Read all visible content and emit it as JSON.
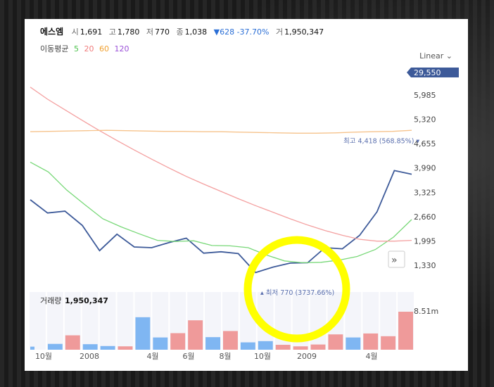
{
  "header": {
    "name": "에스엠",
    "open_label": "시",
    "open": "1,691",
    "high_label": "고",
    "high": "1,780",
    "low_label": "저",
    "low": "770",
    "close_label": "종",
    "close": "1,038",
    "change": "▼628 -37.70%",
    "volume_label": "거",
    "volume": "1,950,347"
  },
  "moving_average": {
    "label": "이동평균",
    "periods": [
      {
        "text": "5",
        "color": "#4cc24c"
      },
      {
        "text": "20",
        "color": "#f07b7b"
      },
      {
        "text": "60",
        "color": "#f0a030"
      },
      {
        "text": "120",
        "color": "#9a50d8"
      }
    ]
  },
  "scale_selector": {
    "label": "Linear",
    "icon": "chevron-down-icon"
  },
  "current_price_tag": "29,550",
  "expand_icon": "double-chevron-right-icon",
  "annotation_color": "#ffff00",
  "chart_data": {
    "type": "line",
    "x_labels": [
      "10월",
      "2008",
      "4월",
      "6월",
      "8월",
      "10월",
      "2009",
      "4월"
    ],
    "price_ticks": [
      "5,985",
      "5,320",
      "4,655",
      "3,990",
      "3,325",
      "2,660",
      "1,995",
      "1,330"
    ],
    "ylim": [
      1000,
      6500
    ],
    "high_marker": {
      "text": "최고 4,418 (568.85%)",
      "value": 4418
    },
    "low_marker": {
      "text": "최저 770 (3737.66%)",
      "value": 770
    },
    "series": [
      {
        "name": "price",
        "color": "#3d5a99",
        "values": [
          3120,
          2760,
          2810,
          2420,
          1730,
          2180,
          1830,
          1810,
          1950,
          2070,
          1660,
          1700,
          1650,
          1130,
          1280,
          1390,
          1400,
          1810,
          1780,
          2150,
          2790,
          3920,
          3820
        ]
      },
      {
        "name": "5",
        "color": "#78d878",
        "values": [
          4150,
          3880,
          3390,
          2990,
          2600,
          2380,
          2190,
          2010,
          1980,
          2000,
          1870,
          1860,
          1810,
          1610,
          1450,
          1400,
          1410,
          1470,
          1570,
          1760,
          2100,
          2580
        ]
      },
      {
        "name": "20",
        "color": "#f4a0a0",
        "values": [
          6200,
          5870,
          5580,
          5290,
          5010,
          4740,
          4480,
          4230,
          3990,
          3760,
          3550,
          3350,
          3150,
          2960,
          2780,
          2600,
          2430,
          2280,
          2150,
          2040,
          1990,
          1990,
          2010
        ]
      },
      {
        "name": "60",
        "color": "#f6c38c",
        "values": [
          4980,
          4990,
          5000,
          5010,
          5020,
          5010,
          5000,
          4990,
          4990,
          4980,
          4980,
          4970,
          4960,
          4950,
          4940,
          4940,
          4950,
          4970,
          4980,
          4990,
          5020
        ]
      }
    ],
    "volume": {
      "label": "거래량",
      "value": "1,950,347",
      "axis_label": "8.51m",
      "max": 8510000,
      "bars": [
        {
          "v": 500000,
          "up": false
        },
        {
          "v": 950000,
          "up": false
        },
        {
          "v": 2350000,
          "up": true
        },
        {
          "v": 900000,
          "up": false
        },
        {
          "v": 600000,
          "up": false
        },
        {
          "v": 550000,
          "up": true
        },
        {
          "v": 5300000,
          "up": false
        },
        {
          "v": 2000000,
          "up": false
        },
        {
          "v": 2700000,
          "up": true
        },
        {
          "v": 4800000,
          "up": true
        },
        {
          "v": 2050000,
          "up": false
        },
        {
          "v": 3050000,
          "up": true
        },
        {
          "v": 1200000,
          "up": false
        },
        {
          "v": 1400000,
          "up": false
        },
        {
          "v": 800000,
          "up": true
        },
        {
          "v": 550000,
          "up": true
        },
        {
          "v": 850000,
          "up": true
        },
        {
          "v": 2500000,
          "up": true
        },
        {
          "v": 2000000,
          "up": false
        },
        {
          "v": 2650000,
          "up": true
        },
        {
          "v": 2200000,
          "up": true
        },
        {
          "v": 6200000,
          "up": true
        }
      ]
    }
  }
}
